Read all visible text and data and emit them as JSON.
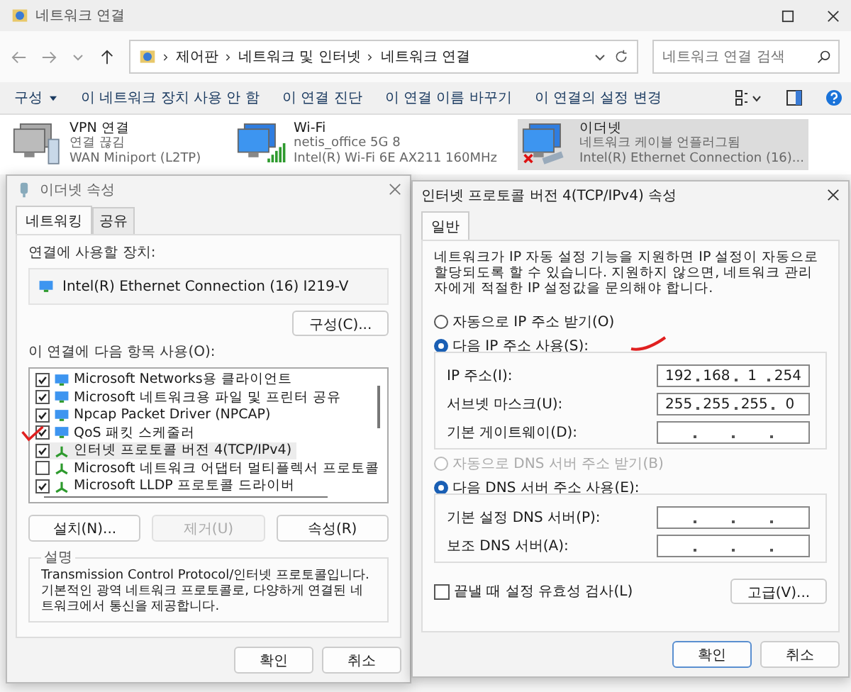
{
  "window": {
    "title": "네트워크 연결"
  },
  "address_bar": {
    "path": [
      "제어판",
      "네트워크 및 인터넷",
      "네트워크 연결"
    ]
  },
  "search": {
    "placeholder": "네트워크 연결 검색"
  },
  "commands": [
    {
      "label": "구성",
      "kind": "menu"
    },
    {
      "label": "이 네트워크 장치 사용 안 함",
      "kind": "plain"
    },
    {
      "label": "이 연결 진단",
      "kind": "plain"
    },
    {
      "label": "이 연결 이름 바꾸기",
      "kind": "plain"
    },
    {
      "label": "이 연결의 설정 변경",
      "kind": "plain"
    }
  ],
  "connections": [
    {
      "name": "VPN 연결",
      "status": "연결 끊김",
      "device": "WAN Miniport (L2TP)",
      "kind": "vpn",
      "selected": false
    },
    {
      "name": "Wi-Fi",
      "status": "netis_office 5G 8",
      "device": "Intel(R) Wi-Fi 6E AX211 160MHz",
      "kind": "wifi",
      "selected": false
    },
    {
      "name": "이더넷",
      "status": "네트워크 케이블 언플러그됨",
      "device": "Intel(R) Ethernet Connection (16)...",
      "kind": "ethernet",
      "selected": true
    }
  ],
  "ethernet_dialog": {
    "title": "이더넷 속성",
    "tabs": [
      {
        "label": "네트워킹",
        "selected": true
      },
      {
        "label": "공유",
        "selected": false
      }
    ],
    "device_label": "연결에 사용할 장치:",
    "device": "Intel(R) Ethernet Connection (16) I219-V",
    "configure_button": "구성(C)...",
    "items_label": "이 연결에 다음 항목 사용(O):",
    "items": [
      {
        "label": "Microsoft Networks용 클라이언트",
        "checked": true,
        "selected": false,
        "kind": "client"
      },
      {
        "label": "Microsoft 네트워크용 파일 및 프린터 공유",
        "checked": true,
        "selected": false,
        "kind": "client"
      },
      {
        "label": "Npcap Packet Driver (NPCAP)",
        "checked": true,
        "selected": false,
        "kind": "client"
      },
      {
        "label": "QoS 패킷 스케줄러",
        "checked": true,
        "selected": false,
        "kind": "client"
      },
      {
        "label": "인터넷 프로토콜 버전 4(TCP/IPv4)",
        "checked": true,
        "selected": true,
        "kind": "protocol"
      },
      {
        "label": "Microsoft 네트워크 어댑터 멀티플렉서 프로토콜",
        "checked": false,
        "selected": false,
        "kind": "protocol"
      },
      {
        "label": "Microsoft LLDP 프로토콜 드라이버",
        "checked": true,
        "selected": false,
        "kind": "protocol"
      }
    ],
    "buttons": [
      {
        "label": "설치(N)...",
        "disabled": false
      },
      {
        "label": "제거(U)",
        "disabled": true
      },
      {
        "label": "속성(R)",
        "disabled": false
      }
    ],
    "description_label": "설명",
    "description": "Transmission Control Protocol/인터넷 프로토콜입니다. 기본적인 광역 네트워크 프로토콜로, 다양하게 연결된 네트워크에서 통신을 제공합니다.",
    "ok_button": "확인",
    "cancel_button": "취소"
  },
  "ipv4_dialog": {
    "title": "인터넷 프로토콜 버전 4(TCP/IPv4) 속성",
    "tab": "일반",
    "intro": "네트워크가 IP 자동 설정 기능을 지원하면 IP 설정이 자동으로 할당되도록 할 수 있습니다. 지원하지 않으면, 네트워크 관리자에게 적절한 IP 설정값을 문의해야 합니다.",
    "ip_options": [
      {
        "label": "자동으로 IP 주소 받기(O)",
        "selected": false,
        "disabled": false
      },
      {
        "label": "다음 IP 주소 사용(S):",
        "selected": true,
        "disabled": false
      }
    ],
    "ip_fields": [
      {
        "label": "IP 주소(I):",
        "octets": [
          "192",
          "168",
          "1",
          "254"
        ]
      },
      {
        "label": "서브넷 마스크(U):",
        "octets": [
          "255",
          "255",
          "255",
          "0"
        ]
      },
      {
        "label": "기본 게이트웨이(D):"
      }
    ],
    "dns_options": [
      {
        "label": "자동으로 DNS 서버 주소 받기(B)",
        "selected": false,
        "disabled": true
      },
      {
        "label": "다음 DNS 서버 주소 사용(E):",
        "selected": true,
        "disabled": false
      }
    ],
    "dns_fields": [
      {
        "label": "기본 설정 DNS 서버(P):"
      },
      {
        "label": "보조 DNS 서버(A):"
      }
    ],
    "validate": {
      "label": "끝낼 때 설정 유효성 검사(L)",
      "checked": false
    },
    "advanced_button": "고급(V)...",
    "ok_button": "확인",
    "cancel_button": "취소"
  }
}
